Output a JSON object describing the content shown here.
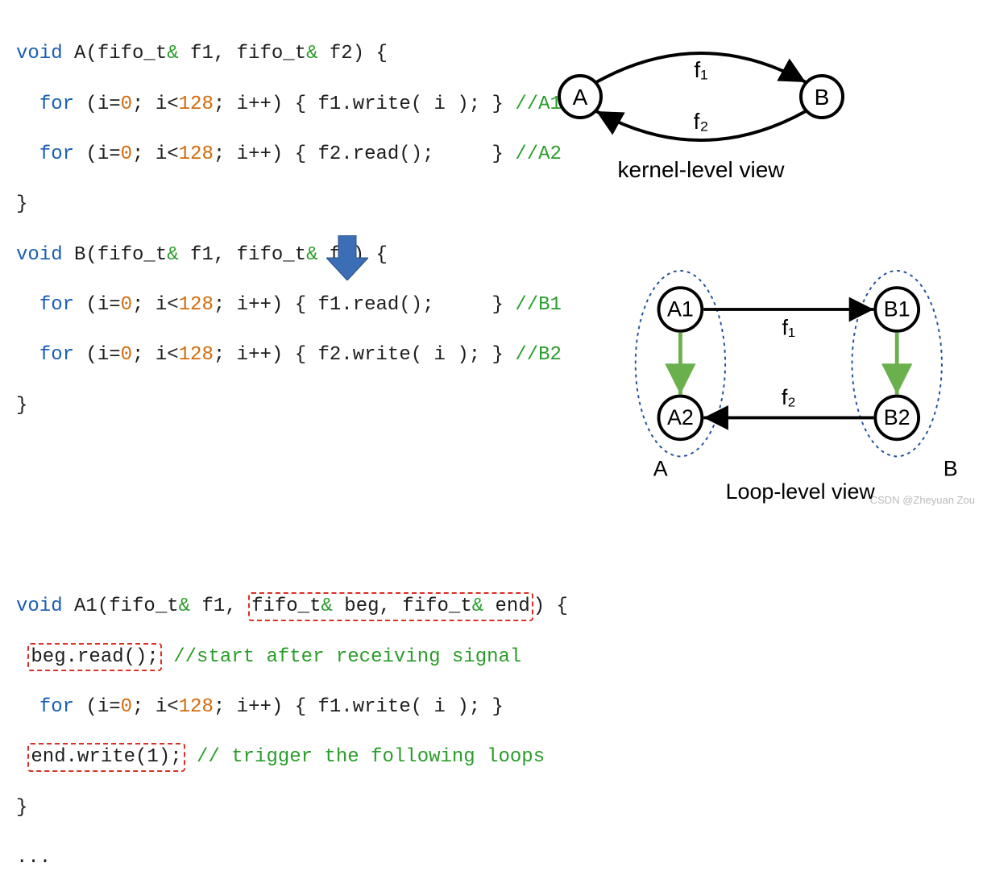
{
  "code": {
    "funcA": {
      "sig_kw": "void",
      "sig_rest": " A(fifo_t",
      "sig_amp1": "&",
      "sig_mid": " f1, fifo_t",
      "sig_amp2": "&",
      "sig_end": " f2) {",
      "l1_for_kw": "for",
      "l1_for1": " (i=",
      "l1_zero": "0",
      "l1_mid": "; i<",
      "l1_128": "128",
      "l1_rest": "; i++) { f1.write( i ); } ",
      "l1_cmt": "//A1",
      "l2_for_kw": "for",
      "l2_for1": " (i=",
      "l2_zero": "0",
      "l2_mid": "; i<",
      "l2_128": "128",
      "l2_rest": "; i++) { f2.read();     } ",
      "l2_cmt": "//A2",
      "close": "}"
    },
    "funcB": {
      "sig_kw": "void",
      "sig_rest": " B(fifo_t",
      "sig_amp1": "&",
      "sig_mid": " f1, fifo_t",
      "sig_amp2": "&",
      "sig_end": " f2) {",
      "l1_for_kw": "for",
      "l1_for1": " (i=",
      "l1_zero": "0",
      "l1_mid": "; i<",
      "l1_128": "128",
      "l1_rest": "; i++) { f1.read();     } ",
      "l1_cmt": "//B1",
      "l2_for_kw": "for",
      "l2_for1": " (i=",
      "l2_zero": "0",
      "l2_mid": "; i<",
      "l2_128": "128",
      "l2_rest": "; i++) { f2.write( i ); } ",
      "l2_cmt": "//B2",
      "close": "}"
    },
    "funcA1": {
      "sig_kw": "void",
      "sig_rest1": " A1(fifo_t",
      "sig_amp1": "&",
      "sig_rest2": " f1, ",
      "boxed_sig_part1": "fifo_t",
      "boxed_sig_amp2": "&",
      "boxed_sig_part2": " beg, fifo_t",
      "boxed_sig_amp3": "&",
      "boxed_sig_part3": " end",
      "sig_end": ") {",
      "beg_read": "beg.read();",
      "beg_cmt": " //start after receiving signal",
      "for_kw": "for",
      "for1": " (i=",
      "zero": "0",
      "mid": "; i<",
      "n128": "128",
      "rest": "; i++) { f1.write( i ); }",
      "end_write": "end.write(1);",
      "end_cmt": " // trigger the following loops",
      "close": "}",
      "dots": "..."
    }
  },
  "graph_top": {
    "nodeA": "A",
    "nodeB": "B",
    "edge_top": "f₁",
    "edge_bot": "f₂",
    "caption": "kernel-level view"
  },
  "graph_bottom": {
    "A1": "A1",
    "A2": "A2",
    "B1": "B1",
    "B2": "B2",
    "edge_f1": "f₁",
    "edge_f2": "f₂",
    "groupA": "A",
    "groupB": "B",
    "caption": "Loop-level view"
  },
  "watermark": "CSDN @Zheyuan Zou"
}
